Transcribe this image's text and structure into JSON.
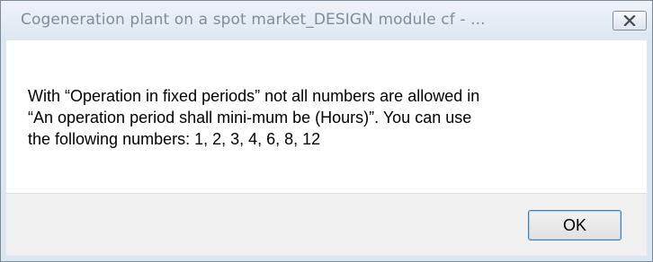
{
  "window": {
    "title": "Cogeneration plant on a spot market_DESIGN module cf - ..."
  },
  "message": {
    "lines": [
      "With “Operation in fixed periods” not all numbers are allowed in",
      "“An operation period shall mini-mum be (Hours)”.  You can use",
      "the following numbers: 1, 2, 3, 4, 6, 8, 12"
    ]
  },
  "buttons": {
    "ok_label": "OK",
    "close_icon": "close-x-icon"
  },
  "colors": {
    "titlebar": "#dde7f1",
    "title_text": "#7f8c99",
    "content_bg": "#ffffff",
    "footer_bg": "#f0f0f0",
    "ok_border": "#3c7fb1"
  }
}
